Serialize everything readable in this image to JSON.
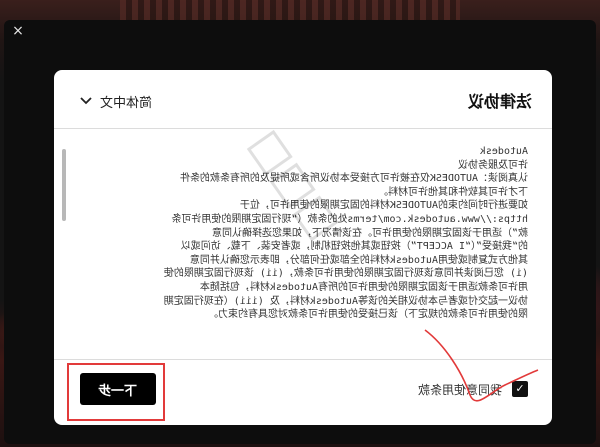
{
  "window": {
    "close_glyph": "×"
  },
  "dialog": {
    "title": "法律协议",
    "language": "简体中文",
    "language_icon": "chevron-down-icon",
    "agreement_text": "Autodesk\n许可及服务协议\n认真阅读：AUTODESK仅在被许可方接受本协议所含或所提及的所有条款的条件\n下才许可其软件和其他许可材料。\n如要进行时间约束的AUTODESK材料的固定期限的使用许可，位于\nhttps://www.autodesk.com/terms处的条款（“现行固定期限的使用许可条\n款”）适用于该固定期限的使用许可。在该情况下，如果您选择确认同意\n的“我接受”（“I ACCEPT”）按钮或其他按钮机制，或者安装、下载、访问或以\n其他方式复制或使用Autodesk材料的全部或任何部分，即表示您确认并同意\n(i) 您已阅读并同意该现行固定期限的使用许可条款，(ii) 该现行固定期限的使\n用许可条款适用于该固定期限的使用许可的所有Autodesk材料，包括随本\n协议一起交付或者与本协议相关的该等Autodesk材料，及 (iii)（在现行固定期\n限的使用许可条款的规定下）该已接受的使用许可条款对您具有约束力。",
    "next_button": "下一步",
    "agree_label": "我同意使用条款",
    "agree_checked": true,
    "checkbox_glyph": "✓"
  },
  "colors": {
    "annotation_red": "#e23a3a",
    "button_bg": "#000000",
    "dialog_bg": "#ffffff"
  }
}
